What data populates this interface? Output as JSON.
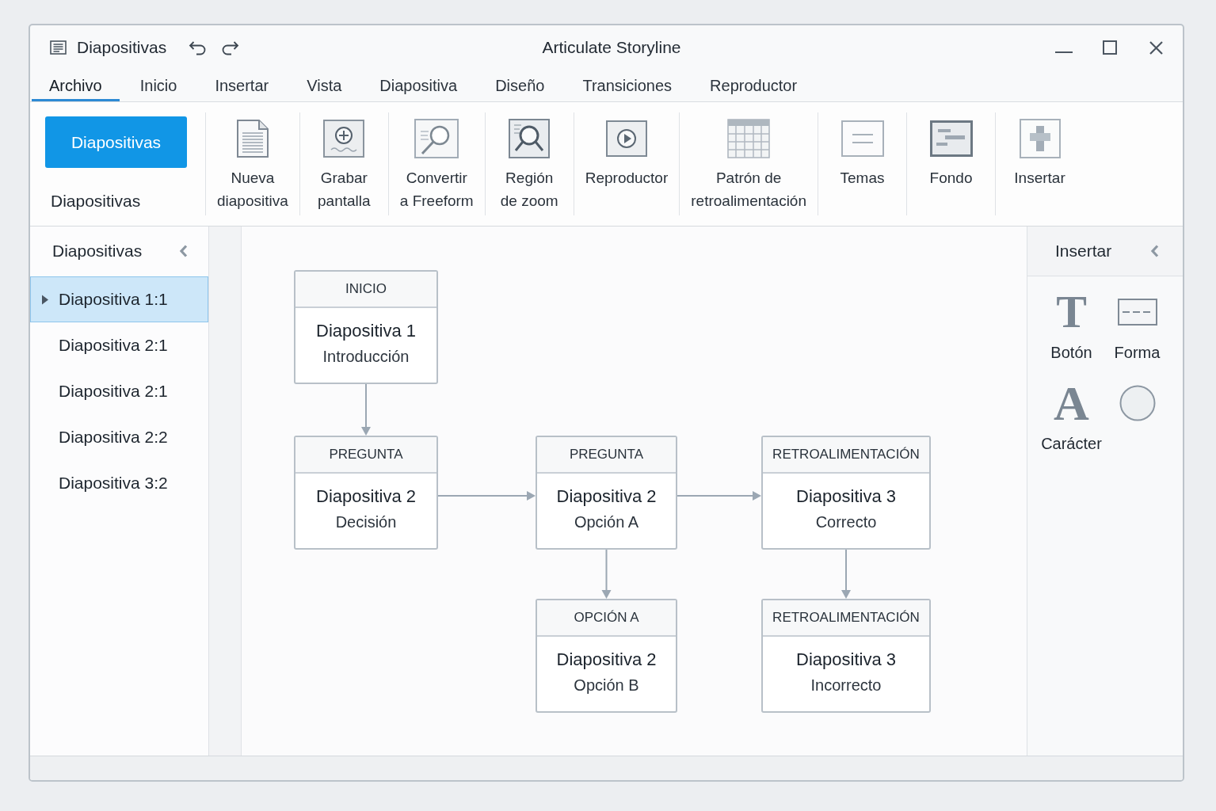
{
  "window": {
    "document_title": "Diapositivas",
    "app_title": "Articulate Storyline"
  },
  "menu_tabs": [
    {
      "label": "Archivo",
      "selected": true
    },
    {
      "label": "Inicio",
      "selected": false
    },
    {
      "label": "Insertar",
      "selected": false
    },
    {
      "label": "Vista",
      "selected": false
    },
    {
      "label": "Diapositiva",
      "selected": false
    },
    {
      "label": "Diseño",
      "selected": false
    },
    {
      "label": "Transiciones",
      "selected": false
    },
    {
      "label": "Reproductor",
      "selected": false
    }
  ],
  "ribbon": {
    "primary_button": "Diapositivas",
    "group_label": "Diapositivas",
    "commands": [
      {
        "kind": "page",
        "label": "Nueva\ndiapositiva"
      },
      {
        "kind": "record",
        "label": "Grabar\npantalla"
      },
      {
        "kind": "convert",
        "label": "Convertir\na Freeform"
      },
      {
        "kind": "zoom",
        "label": "Región\nde zoom"
      },
      {
        "kind": "player",
        "label": "Reproductor"
      },
      {
        "kind": "grid",
        "label": "Patrón de\nretroalimentación"
      },
      {
        "kind": "themes",
        "label": "Temas"
      },
      {
        "kind": "background",
        "label": "Fondo"
      },
      {
        "kind": "insert",
        "label": "Insertar"
      }
    ]
  },
  "slides_panel": {
    "title": "Diapositivas",
    "items": [
      {
        "label": "Diapositiva 1:1",
        "selected": true
      },
      {
        "label": "Diapositiva 2:1",
        "selected": false
      },
      {
        "label": "Diapositiva 2:1",
        "selected": false
      },
      {
        "label": "Diapositiva 2:2",
        "selected": false
      },
      {
        "label": "Diapositiva 3:2",
        "selected": false
      }
    ]
  },
  "canvas": {
    "flow": {
      "tag": "INICIO",
      "title": "Diapositiva 1",
      "subtitle": "Introducción",
      "children": [
        {
          "tag": "PREGUNTA",
          "title": "Diapositiva 2",
          "subtitle": "Decisión",
          "children": [
            {
              "tag": "PREGUNTA",
              "title": "Diapositiva 2",
              "subtitle": "Opción A",
              "children": [
                {
                  "tag": "OPCIÓN A",
                  "title": "Diapositiva 2",
                  "subtitle": "Opción B"
                },
                {
                  "tag": "RETROALIMENTACIÓN",
                  "title": "Diapositiva 3",
                  "subtitle": "Correcto",
                  "children": [
                    {
                      "tag": "RETROALIMENTACIÓN",
                      "title": "Diapositiva 3",
                      "subtitle": "Incorrecto"
                    }
                  ]
                }
              ]
            }
          ]
        }
      ]
    }
  },
  "insert_panel": {
    "title": "Insertar",
    "tools": [
      {
        "kind": "text",
        "glyph": "T",
        "label": "Botón"
      },
      {
        "kind": "shape",
        "label": "Forma"
      },
      {
        "kind": "character",
        "glyph": "A",
        "label": "Carácter"
      },
      {
        "kind": "circle"
      }
    ]
  }
}
